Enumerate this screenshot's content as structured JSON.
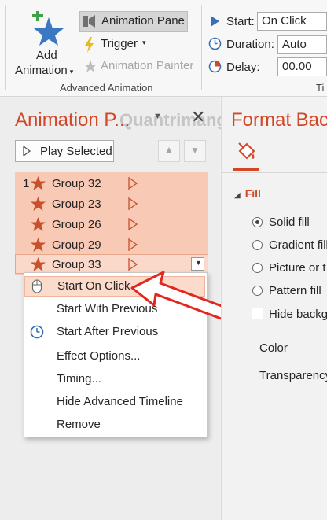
{
  "ribbon": {
    "add_animation_line1": "Add",
    "add_animation_line2": "Animation",
    "animation_pane": "Animation Pane",
    "trigger": "Trigger",
    "animation_painter": "Animation Painter",
    "group_label": "Advanced Animation",
    "group_label_right": "Ti",
    "start_label": "Start:",
    "start_value": "On Click",
    "duration_label": "Duration:",
    "duration_value": "Auto",
    "delay_label": "Delay:",
    "delay_value": "00.00"
  },
  "animation_pane": {
    "title": "Animation P...",
    "play_selected": "Play Selected",
    "items": [
      {
        "order": "1",
        "label": "Group 32"
      },
      {
        "order": "",
        "label": "Group 23"
      },
      {
        "order": "",
        "label": "Group 26"
      },
      {
        "order": "",
        "label": "Group 29"
      },
      {
        "order": "",
        "label": "Group 33"
      }
    ]
  },
  "context_menu": {
    "items": [
      "Start On Click",
      "Start With Previous",
      "Start After Previous",
      "Effect Options...",
      "Timing...",
      "Hide Advanced Timeline",
      "Remove"
    ]
  },
  "format_pane": {
    "title": "Format Bac",
    "fill_label": "Fill",
    "options": [
      "Solid fill",
      "Gradient fill",
      "Picture or t",
      "Pattern fill"
    ],
    "hide_background": "Hide backg",
    "color_label": "Color",
    "transparency_label": "Transparency"
  },
  "watermark": "Quantrimang",
  "colors": {
    "accent": "#d24726",
    "selection": "#f8c9b4",
    "star": "#c8502d",
    "arrow": "#e0281f"
  }
}
